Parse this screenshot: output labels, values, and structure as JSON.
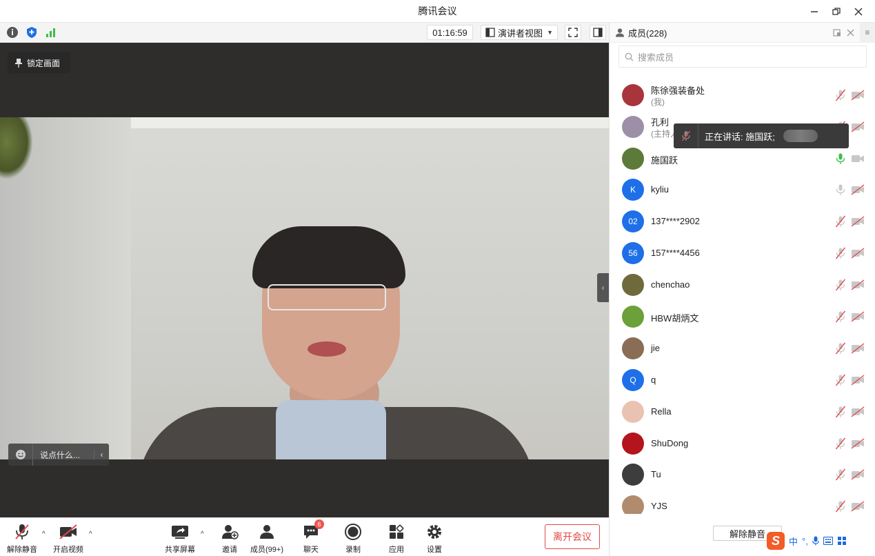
{
  "window": {
    "title": "腾讯会议"
  },
  "topbar": {
    "timer": "01:16:59",
    "view_label": "演讲者视图"
  },
  "video": {
    "lock_label": "锁定画面",
    "chat_placeholder": "说点什么..."
  },
  "toolbar": {
    "unmute": "解除静音",
    "start_video": "开启视频",
    "share_screen": "共享屏幕",
    "invite": "邀请",
    "members": "成员(99+)",
    "chat": "聊天",
    "chat_badge": "6",
    "record": "录制",
    "apps": "应用",
    "settings": "设置",
    "leave": "离开会议"
  },
  "panel": {
    "title": "成员(228)",
    "search_placeholder": "搜索成员",
    "unmute_all": "解除静音",
    "members": [
      {
        "name": "陈徐强装备处",
        "sub": "(我)",
        "avatar_text": "",
        "avatar_color": "#a8353b",
        "mic": "muted",
        "cam": "off"
      },
      {
        "name": "孔利",
        "sub": "(主持人)",
        "avatar_text": "",
        "avatar_color": "#9d8fa8",
        "mic": "muted",
        "cam": "off"
      },
      {
        "name": "施国跃",
        "sub": "",
        "avatar_text": "",
        "avatar_color": "#5c7a3a",
        "mic": "active",
        "cam": "on"
      },
      {
        "name": "kyliu",
        "sub": "",
        "avatar_text": "K",
        "avatar_color": "#1e6fe8",
        "mic": "idle",
        "cam": "off"
      },
      {
        "name": "137****2902",
        "sub": "",
        "avatar_text": "02",
        "avatar_color": "#1e6fe8",
        "mic": "muted",
        "cam": "off"
      },
      {
        "name": "157****4456",
        "sub": "",
        "avatar_text": "56",
        "avatar_color": "#1e6fe8",
        "mic": "muted",
        "cam": "off"
      },
      {
        "name": "chenchao",
        "sub": "",
        "avatar_text": "",
        "avatar_color": "#6f6a3c",
        "mic": "muted",
        "cam": "off"
      },
      {
        "name": "HBW胡炳文",
        "sub": "",
        "avatar_text": "",
        "avatar_color": "#6ba03a",
        "mic": "muted",
        "cam": "off"
      },
      {
        "name": "jie",
        "sub": "",
        "avatar_text": "",
        "avatar_color": "#8a6d55",
        "mic": "muted",
        "cam": "off"
      },
      {
        "name": "q",
        "sub": "",
        "avatar_text": "Q",
        "avatar_color": "#1e6fe8",
        "mic": "muted",
        "cam": "off"
      },
      {
        "name": "Rella",
        "sub": "",
        "avatar_text": "",
        "avatar_color": "#e9c2b2",
        "mic": "muted",
        "cam": "off"
      },
      {
        "name": "ShuDong",
        "sub": "",
        "avatar_text": "",
        "avatar_color": "#b3141d",
        "mic": "muted",
        "cam": "off"
      },
      {
        "name": "Tu",
        "sub": "",
        "avatar_text": "",
        "avatar_color": "#3d3d3d",
        "mic": "muted",
        "cam": "off"
      },
      {
        "name": "YJS",
        "sub": "",
        "avatar_text": "",
        "avatar_color": "#b08b6e",
        "mic": "muted",
        "cam": "off"
      }
    ]
  },
  "tooltip": {
    "speaking": "正在讲话: 施国跃;"
  },
  "ime": {
    "logo": "S",
    "lang": "中"
  },
  "colors": {
    "accent_blue": "#1e6fe8",
    "leave_red": "#e04a43",
    "active_green": "#3bbf4b",
    "muted_red": "#e0494c"
  }
}
